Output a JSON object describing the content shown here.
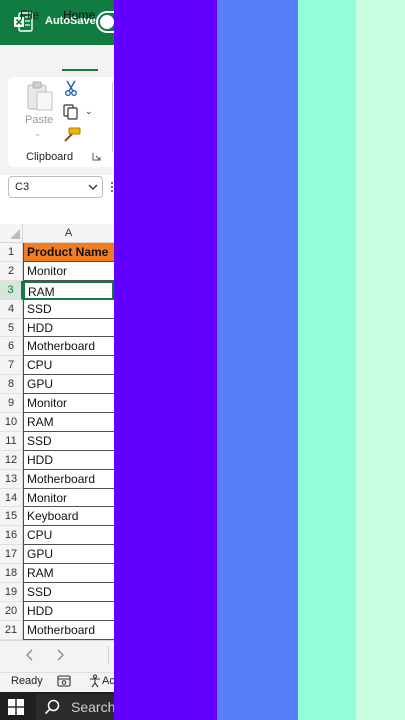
{
  "titlebar": {
    "autosave_label": "AutoSave",
    "autosave_on": true,
    "brand_color": "#107c41"
  },
  "tabs": [
    {
      "label": "File"
    },
    {
      "label": "Home",
      "active": true
    }
  ],
  "ribbon": {
    "paste_label": "Paste",
    "group_label": "Clipboard",
    "icons": [
      "paste-icon",
      "cut-icon",
      "copy-icon",
      "format-painter-icon",
      "dialog-launcher-icon"
    ]
  },
  "namebox": {
    "value": "C3"
  },
  "sheet": {
    "column_header": "A",
    "selected_row": 3,
    "header_fill": "#f47c20",
    "rows": [
      {
        "num": "1",
        "value": "Product Name"
      },
      {
        "num": "2",
        "value": "Monitor"
      },
      {
        "num": "3",
        "value": "RAM"
      },
      {
        "num": "4",
        "value": "SSD"
      },
      {
        "num": "5",
        "value": "HDD"
      },
      {
        "num": "6",
        "value": "Motherboard"
      },
      {
        "num": "7",
        "value": "CPU"
      },
      {
        "num": "8",
        "value": "GPU"
      },
      {
        "num": "9",
        "value": "Monitor"
      },
      {
        "num": "10",
        "value": "RAM"
      },
      {
        "num": "11",
        "value": "SSD"
      },
      {
        "num": "12",
        "value": "HDD"
      },
      {
        "num": "13",
        "value": "Motherboard"
      },
      {
        "num": "14",
        "value": "Monitor"
      },
      {
        "num": "15",
        "value": "Keyboard"
      },
      {
        "num": "16",
        "value": "CPU"
      },
      {
        "num": "17",
        "value": "GPU"
      },
      {
        "num": "18",
        "value": "RAM"
      },
      {
        "num": "19",
        "value": "SSD"
      },
      {
        "num": "20",
        "value": "HDD"
      },
      {
        "num": "21",
        "value": "Motherboard"
      }
    ]
  },
  "statusbar": {
    "ready": "Ready",
    "accessibility": "Ac"
  },
  "taskbar": {
    "search": "Search"
  },
  "stripes": [
    {
      "color": "#6200ff"
    },
    {
      "color": "#567ff8"
    },
    {
      "color": "#94fcd9"
    },
    {
      "color": "#c8fde0"
    }
  ]
}
